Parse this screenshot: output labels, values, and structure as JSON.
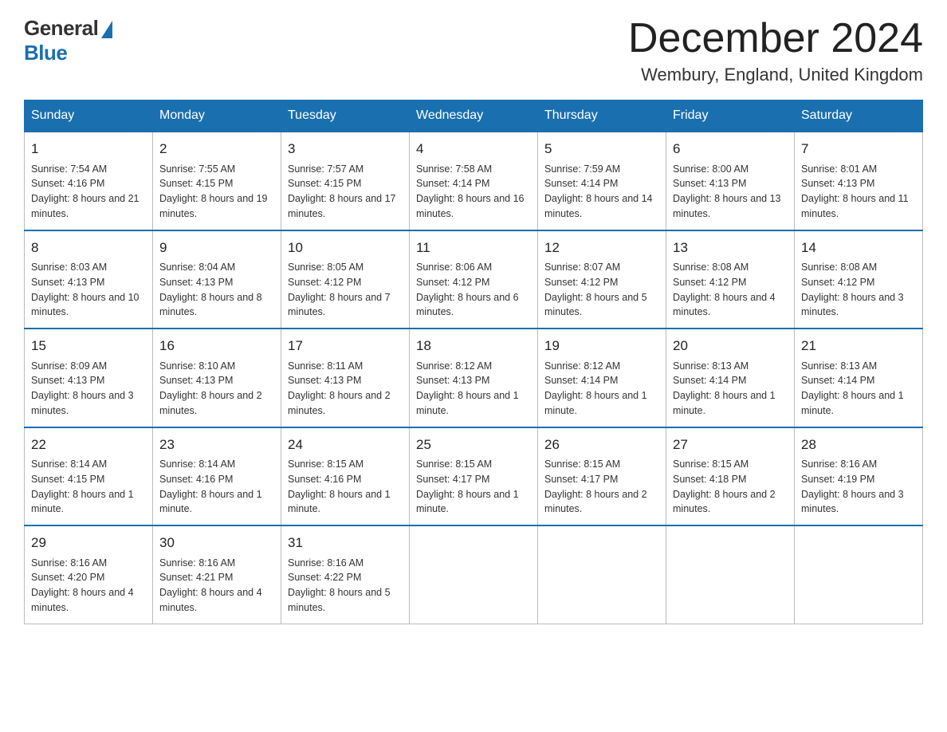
{
  "header": {
    "logo_general": "General",
    "logo_blue": "Blue",
    "month_title": "December 2024",
    "location": "Wembury, England, United Kingdom"
  },
  "days_of_week": [
    "Sunday",
    "Monday",
    "Tuesday",
    "Wednesday",
    "Thursday",
    "Friday",
    "Saturday"
  ],
  "weeks": [
    [
      {
        "day": "1",
        "sunrise": "7:54 AM",
        "sunset": "4:16 PM",
        "daylight": "8 hours and 21 minutes."
      },
      {
        "day": "2",
        "sunrise": "7:55 AM",
        "sunset": "4:15 PM",
        "daylight": "8 hours and 19 minutes."
      },
      {
        "day": "3",
        "sunrise": "7:57 AM",
        "sunset": "4:15 PM",
        "daylight": "8 hours and 17 minutes."
      },
      {
        "day": "4",
        "sunrise": "7:58 AM",
        "sunset": "4:14 PM",
        "daylight": "8 hours and 16 minutes."
      },
      {
        "day": "5",
        "sunrise": "7:59 AM",
        "sunset": "4:14 PM",
        "daylight": "8 hours and 14 minutes."
      },
      {
        "day": "6",
        "sunrise": "8:00 AM",
        "sunset": "4:13 PM",
        "daylight": "8 hours and 13 minutes."
      },
      {
        "day": "7",
        "sunrise": "8:01 AM",
        "sunset": "4:13 PM",
        "daylight": "8 hours and 11 minutes."
      }
    ],
    [
      {
        "day": "8",
        "sunrise": "8:03 AM",
        "sunset": "4:13 PM",
        "daylight": "8 hours and 10 minutes."
      },
      {
        "day": "9",
        "sunrise": "8:04 AM",
        "sunset": "4:13 PM",
        "daylight": "8 hours and 8 minutes."
      },
      {
        "day": "10",
        "sunrise": "8:05 AM",
        "sunset": "4:12 PM",
        "daylight": "8 hours and 7 minutes."
      },
      {
        "day": "11",
        "sunrise": "8:06 AM",
        "sunset": "4:12 PM",
        "daylight": "8 hours and 6 minutes."
      },
      {
        "day": "12",
        "sunrise": "8:07 AM",
        "sunset": "4:12 PM",
        "daylight": "8 hours and 5 minutes."
      },
      {
        "day": "13",
        "sunrise": "8:08 AM",
        "sunset": "4:12 PM",
        "daylight": "8 hours and 4 minutes."
      },
      {
        "day": "14",
        "sunrise": "8:08 AM",
        "sunset": "4:12 PM",
        "daylight": "8 hours and 3 minutes."
      }
    ],
    [
      {
        "day": "15",
        "sunrise": "8:09 AM",
        "sunset": "4:13 PM",
        "daylight": "8 hours and 3 minutes."
      },
      {
        "day": "16",
        "sunrise": "8:10 AM",
        "sunset": "4:13 PM",
        "daylight": "8 hours and 2 minutes."
      },
      {
        "day": "17",
        "sunrise": "8:11 AM",
        "sunset": "4:13 PM",
        "daylight": "8 hours and 2 minutes."
      },
      {
        "day": "18",
        "sunrise": "8:12 AM",
        "sunset": "4:13 PM",
        "daylight": "8 hours and 1 minute."
      },
      {
        "day": "19",
        "sunrise": "8:12 AM",
        "sunset": "4:14 PM",
        "daylight": "8 hours and 1 minute."
      },
      {
        "day": "20",
        "sunrise": "8:13 AM",
        "sunset": "4:14 PM",
        "daylight": "8 hours and 1 minute."
      },
      {
        "day": "21",
        "sunrise": "8:13 AM",
        "sunset": "4:14 PM",
        "daylight": "8 hours and 1 minute."
      }
    ],
    [
      {
        "day": "22",
        "sunrise": "8:14 AM",
        "sunset": "4:15 PM",
        "daylight": "8 hours and 1 minute."
      },
      {
        "day": "23",
        "sunrise": "8:14 AM",
        "sunset": "4:16 PM",
        "daylight": "8 hours and 1 minute."
      },
      {
        "day": "24",
        "sunrise": "8:15 AM",
        "sunset": "4:16 PM",
        "daylight": "8 hours and 1 minute."
      },
      {
        "day": "25",
        "sunrise": "8:15 AM",
        "sunset": "4:17 PM",
        "daylight": "8 hours and 1 minute."
      },
      {
        "day": "26",
        "sunrise": "8:15 AM",
        "sunset": "4:17 PM",
        "daylight": "8 hours and 2 minutes."
      },
      {
        "day": "27",
        "sunrise": "8:15 AM",
        "sunset": "4:18 PM",
        "daylight": "8 hours and 2 minutes."
      },
      {
        "day": "28",
        "sunrise": "8:16 AM",
        "sunset": "4:19 PM",
        "daylight": "8 hours and 3 minutes."
      }
    ],
    [
      {
        "day": "29",
        "sunrise": "8:16 AM",
        "sunset": "4:20 PM",
        "daylight": "8 hours and 4 minutes."
      },
      {
        "day": "30",
        "sunrise": "8:16 AM",
        "sunset": "4:21 PM",
        "daylight": "8 hours and 4 minutes."
      },
      {
        "day": "31",
        "sunrise": "8:16 AM",
        "sunset": "4:22 PM",
        "daylight": "8 hours and 5 minutes."
      },
      null,
      null,
      null,
      null
    ]
  ],
  "labels": {
    "sunrise": "Sunrise:",
    "sunset": "Sunset:",
    "daylight": "Daylight:"
  }
}
